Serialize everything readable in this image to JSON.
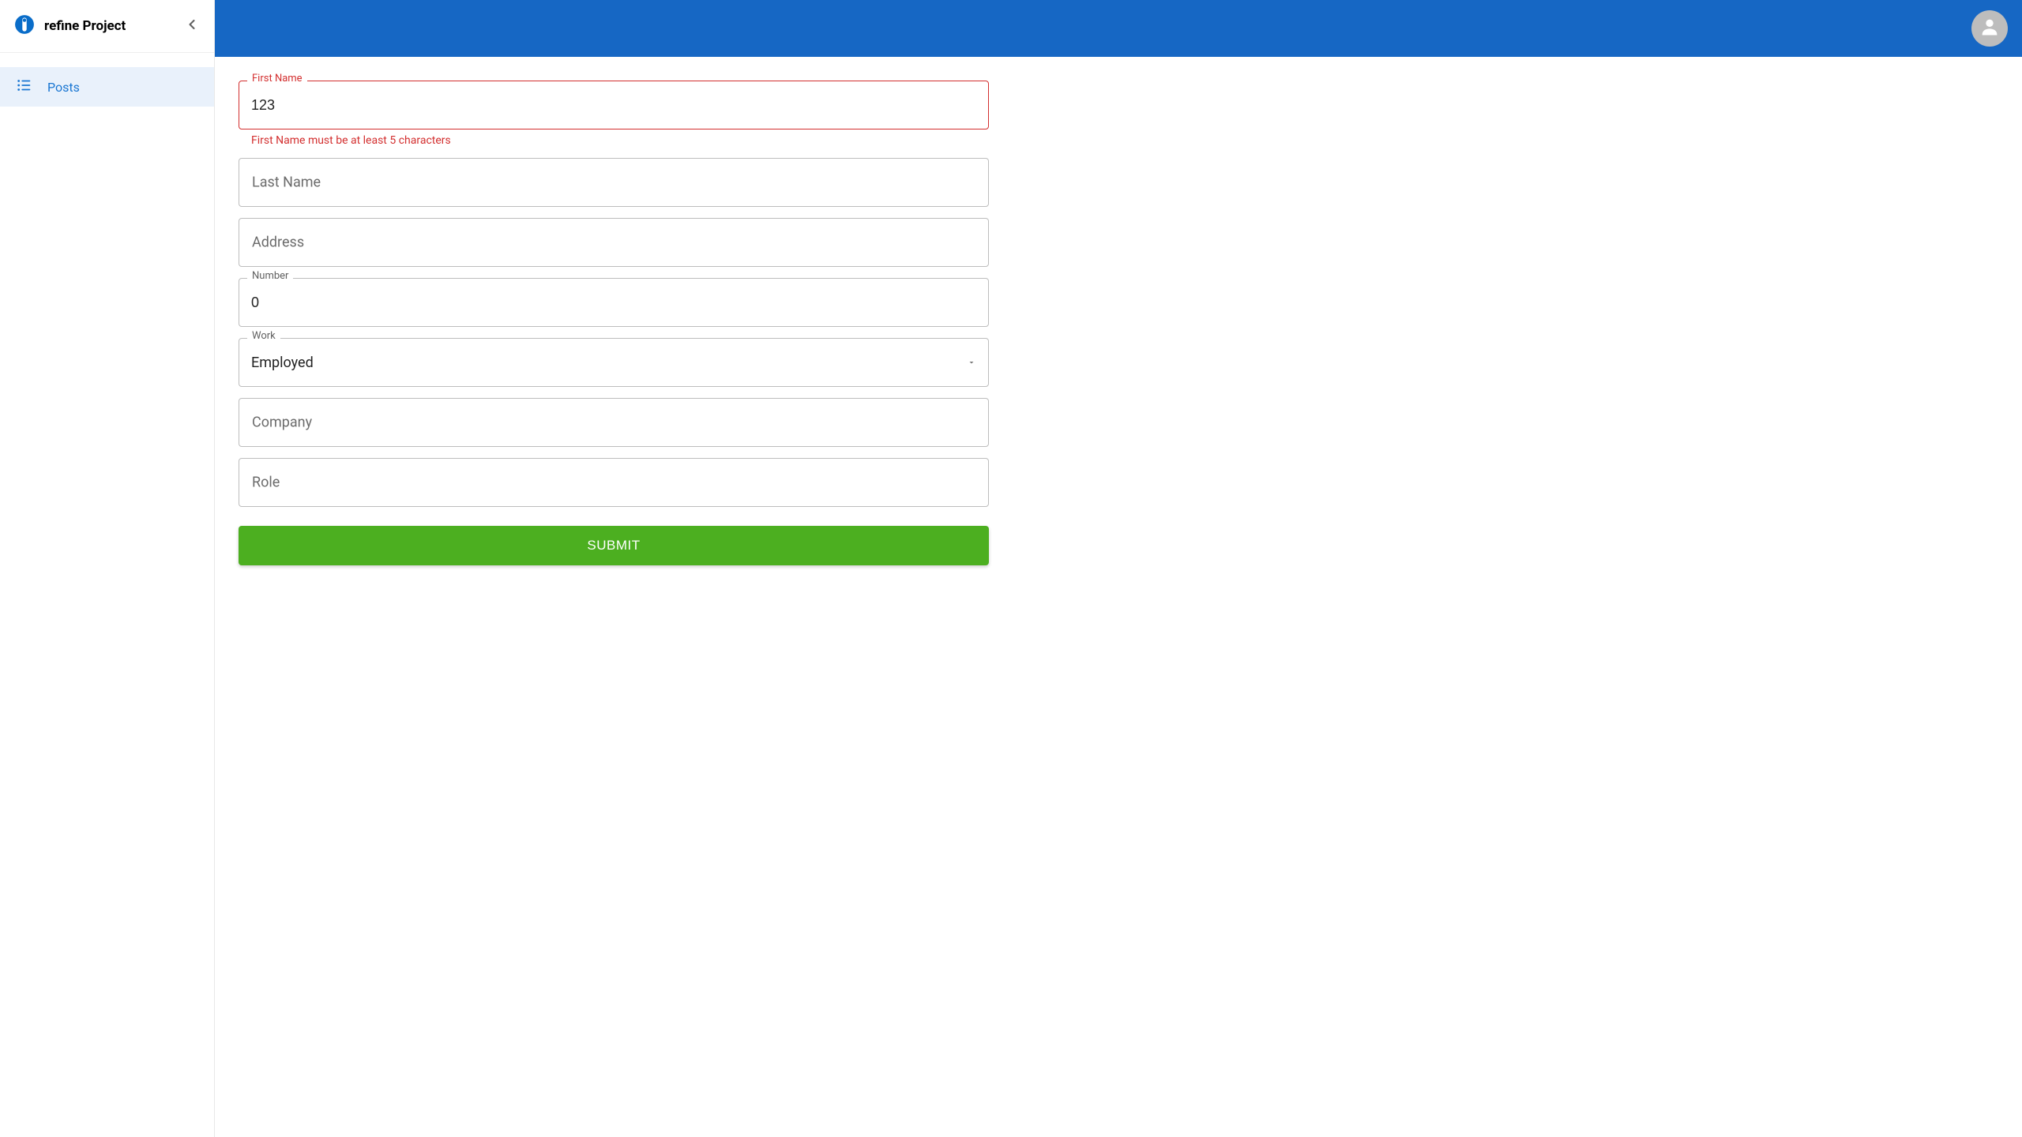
{
  "brand": {
    "title": "refine Project"
  },
  "sidebar": {
    "items": [
      {
        "label": "Posts"
      }
    ]
  },
  "form": {
    "first_name": {
      "label": "First Name",
      "value": "123",
      "error": "First Name must be at least 5 characters"
    },
    "last_name": {
      "placeholder": "Last Name",
      "value": ""
    },
    "address": {
      "placeholder": "Address",
      "value": ""
    },
    "number": {
      "label": "Number",
      "value": "0"
    },
    "work": {
      "label": "Work",
      "value": "Employed"
    },
    "company": {
      "placeholder": "Company",
      "value": ""
    },
    "role": {
      "placeholder": "Role",
      "value": ""
    },
    "submit_label": "SUBMIT"
  }
}
